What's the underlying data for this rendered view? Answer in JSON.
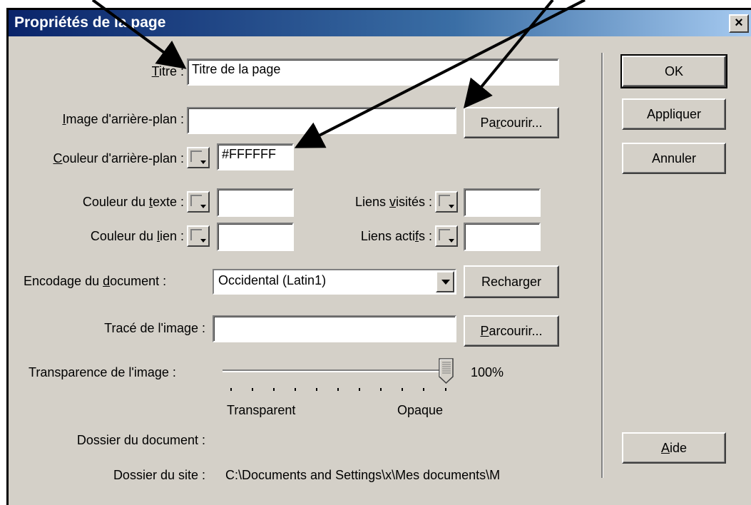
{
  "window": {
    "title": "Propriétés de la page",
    "close": "×"
  },
  "fields": {
    "title_label_u": "T",
    "title_label_rest": "itre :",
    "title_value": "Titre de la page",
    "bg_image_label_u": "I",
    "bg_image_label_rest": "mage d'arrière-plan :",
    "bg_image_value": "",
    "bg_color_label_u": "C",
    "bg_color_label_rest": "ouleur d'arrière-plan :",
    "bg_color_value": "#FFFFFF",
    "text_color_label_a": "Couleur du ",
    "text_color_label_u": "t",
    "text_color_label_b": "exte :",
    "text_color_value": "",
    "link_color_label_a": "Couleur du ",
    "link_color_label_u": "l",
    "link_color_label_b": "ien :",
    "link_color_value": "",
    "visited_label_a": "Liens ",
    "visited_label_u": "v",
    "visited_label_b": "isités :",
    "visited_value": "",
    "active_label_a": "Liens acti",
    "active_label_u": "f",
    "active_label_b": "s :",
    "active_value": "",
    "encoding_label_a": "Encodage du ",
    "encoding_label_u": "d",
    "encoding_label_b": "ocument :",
    "encoding_value": "Occidental (Latin1)",
    "trace_label": "Tracé de l'image :",
    "trace_value": "",
    "transparency_label": "Transparence de l'image :",
    "transparency_value": "100%",
    "transparency_level": 1.0,
    "transparent_label": "Transparent",
    "opaque_label": "Opaque",
    "doc_folder_label": "Dossier du document :",
    "doc_folder_value": "",
    "site_folder_label": "Dossier du site :",
    "site_folder_value": "C:\\Documents and Settings\\x\\Mes documents\\M"
  },
  "buttons": {
    "browse1_a": "Pa",
    "browse1_u": "r",
    "browse1_b": "courir...",
    "reload": "Recharger",
    "browse2_u": "P",
    "browse2_b": "arcourir...",
    "ok": "OK",
    "apply": "Appliquer",
    "cancel": "Annuler",
    "help_u": "A",
    "help_b": "ide"
  }
}
